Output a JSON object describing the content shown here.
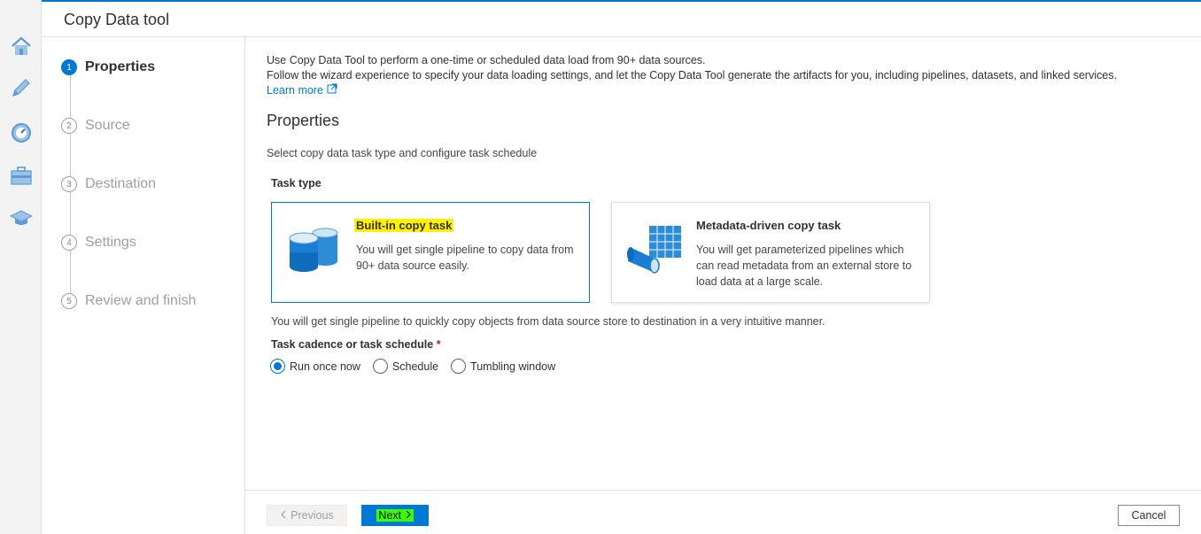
{
  "header": {
    "title": "Copy Data tool"
  },
  "rail": {
    "items": [
      {
        "icon": "home-icon"
      },
      {
        "icon": "pencil-icon"
      },
      {
        "icon": "monitor-icon"
      },
      {
        "icon": "toolbox-icon"
      },
      {
        "icon": "learning-hat-icon"
      }
    ]
  },
  "steps": [
    {
      "number": "1",
      "label": "Properties",
      "active": true
    },
    {
      "number": "2",
      "label": "Source",
      "active": false
    },
    {
      "number": "3",
      "label": "Destination",
      "active": false
    },
    {
      "number": "4",
      "label": "Settings",
      "active": false
    },
    {
      "number": "5",
      "label": "Review and finish",
      "active": false
    }
  ],
  "main": {
    "intro_line1": "Use Copy Data Tool to perform a one-time or scheduled data load from 90+ data sources.",
    "intro_line2": "Follow the wizard experience to specify your data loading settings, and let the Copy Data Tool generate the artifacts for you, including pipelines, datasets, and linked services.",
    "learn_more": "Learn more",
    "section_title": "Properties",
    "section_desc": "Select copy data task type and configure task schedule",
    "task_type_label": "Task type",
    "cards": [
      {
        "title": "Built-in copy task",
        "desc": "You will get single pipeline to copy data from 90+ data source easily.",
        "selected": true
      },
      {
        "title": "Metadata-driven copy task",
        "desc": "You will get parameterized pipelines which can read metadata from an external store to load data at a large scale.",
        "selected": false
      }
    ],
    "type_note": "You will get single pipeline to quickly copy objects from data source store to destination in a very intuitive manner.",
    "cadence_label": "Task cadence or task schedule",
    "required_mark": "*",
    "radios": [
      {
        "label": "Run once now",
        "checked": true
      },
      {
        "label": "Schedule",
        "checked": false
      },
      {
        "label": "Tumbling window",
        "checked": false
      }
    ]
  },
  "footer": {
    "previous": "Previous",
    "next": "Next",
    "cancel": "Cancel"
  },
  "colors": {
    "accent": "#0078d4",
    "highlight_yellow": "#fff200",
    "highlight_green": "#3aff00"
  }
}
